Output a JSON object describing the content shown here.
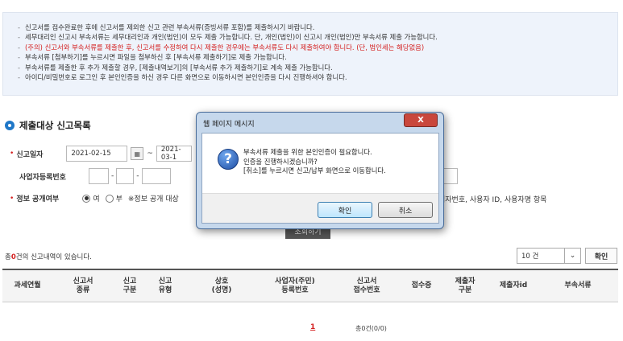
{
  "notice": {
    "lines": [
      "신고서를 접수완료한 후에 신고서를 제외한 신고 관련 부속서류(증빙서류 포함)를 제출하시기 바랍니다.",
      "세무대리인 신고시 부속서류는 세무대리인과 개인(법인)이 모두 제출 가능합니다. 단, 개인(법인)이 신고시 개인(법인)만 부속서류 제출 가능합니다.",
      "(주의) 신고서와 부속서류를 제출한 후, 신고서를 수정하여 다시 제출한 경우에는 부속서류도 다시 제출하여야 합니다. (단, 법인세는 해당없음)",
      "부속서류 [첨부하기]를 누르시면 파일을 첨부하신 후 [부속서류 제출하기]로 제출 가능합니다.",
      "부속서류를 제출한 후 추가 제출할 경우, [제출내역보기]의 [부속서류 추가 제출하기]로 계속 제출 가능합니다.",
      "아이디/비밀번호로 로그인 후 본인인증을 하신 경우 다른 화면으로 이동하시면 본인인증을 다시 진행하셔야 합니다."
    ],
    "bullet": "-"
  },
  "section": {
    "title": "제출대상 신고목록"
  },
  "form": {
    "report_date_label": "신고일자",
    "date_from": "2021-02-15",
    "date_sep": "~",
    "date_to": "2021-03-1",
    "biz_no_label": "사업자등록번호",
    "dash": "-",
    "disclosure_label": "정보 공개여부",
    "yes_label": "여",
    "no_label": "부",
    "disclosure_note": "※정보 공개 대상",
    "disclosure_note_tail": "업자번호, 사용자 ID, 사용자명 항목",
    "search_button": "조회하기"
  },
  "results": {
    "prefix": "총",
    "count": "0",
    "suffix": "건의 신고내역이 있습니다.",
    "page_size": "10 건",
    "confirm": "확인"
  },
  "table": {
    "headers": [
      "과세연월",
      "신고서\n종류",
      "신고\n구분",
      "신고\n유형",
      "상호\n(성명)",
      "사업자(주민)\n등록번호",
      "신고서\n접수번호",
      "접수증",
      "제출자\n구분",
      "제출자id",
      "부속서류"
    ]
  },
  "pager": {
    "page": "1",
    "total": "총0건(0/0)"
  },
  "dialog": {
    "title": "웹 페이지 메시지",
    "close_label": "X",
    "icon": "question-icon",
    "icon_glyph": "?",
    "message_lines": [
      "부속서류 제출을 위한 본인인증이 필요합니다.",
      "인증을 진행하시겠습니까?",
      "[취소]를 누르시면 신고/납부 화면으로 이동합니다."
    ],
    "ok_label": "확인",
    "cancel_label": "취소"
  },
  "colors": {
    "accent": "#1f78c8",
    "required": "#d42020",
    "dialog_frame": "#c6d8ec"
  }
}
